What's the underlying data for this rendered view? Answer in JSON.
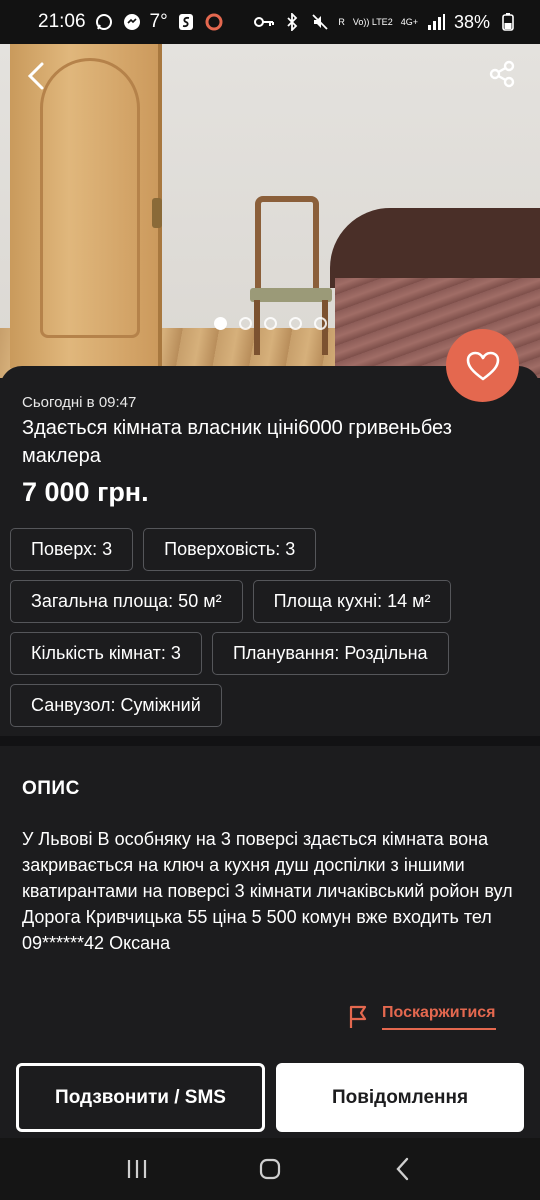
{
  "status_bar": {
    "time": "21:06",
    "temperature": "7°",
    "battery": "38%",
    "network_labels": [
      "R",
      "Vo)) LTE2",
      "4G+"
    ]
  },
  "gallery": {
    "slide_count": 5,
    "active_slide": 1
  },
  "listing": {
    "posted": "Сьогодні в 09:47",
    "title": "Здається кімната власник ціні6000 гривеньбез маклера",
    "price": "7 000 грн."
  },
  "params": [
    [
      "Поверх: 3",
      "Поверховість: 3"
    ],
    [
      "Загальна площа: 50 м²",
      "Площа кухні: 14 м²"
    ],
    [
      "Кількість кімнат: 3",
      "Планування: Роздільна"
    ],
    [
      "Санвузол: Суміжний"
    ]
  ],
  "description": {
    "heading": "ОПИС",
    "text": "У Львові В особняку на 3 поверсі здається кімната вона закривається на ключ а кухня душ доспілки з іншими кватирантами на поверсі 3 кімнати личаківський ройон вул Дорога Кривчицька 55 ціна 5 500 комун вже входить тел 09******42 Оксана"
  },
  "report": {
    "label": "Поскаржитися"
  },
  "actions": {
    "call_label": "Подзвонити / SMS",
    "message_label": "Повідомлення"
  },
  "colors": {
    "accent": "#e4684f",
    "background": "#1c1c1e"
  }
}
